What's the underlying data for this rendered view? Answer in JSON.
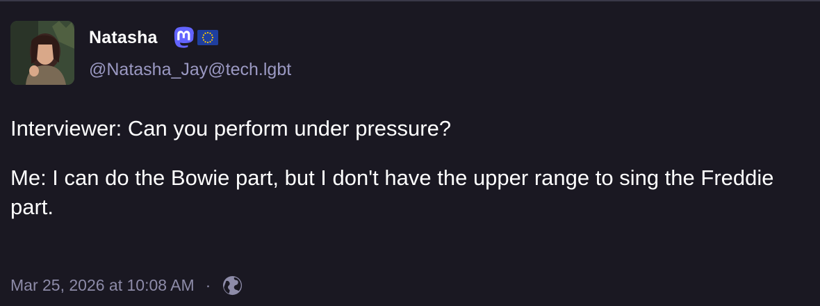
{
  "post": {
    "display_name": "Natasha",
    "handle": "@Natasha_Jay@tech.lgbt",
    "badges": [
      "mastodon-icon",
      "eu-flag-icon"
    ],
    "body": [
      "Interviewer: Can you perform under pressure?",
      "Me: I can do the Bowie part, but I don't have the upper range to sing the Freddie part."
    ],
    "timestamp": "Mar 25, 2026 at 10:08 AM",
    "separator": "·",
    "visibility_icon": "globe-icon"
  },
  "colors": {
    "background": "#1a1822",
    "handle": "#9b99c3",
    "meta": "#8d8ba8",
    "mastodon_brand": "#6364ff"
  }
}
